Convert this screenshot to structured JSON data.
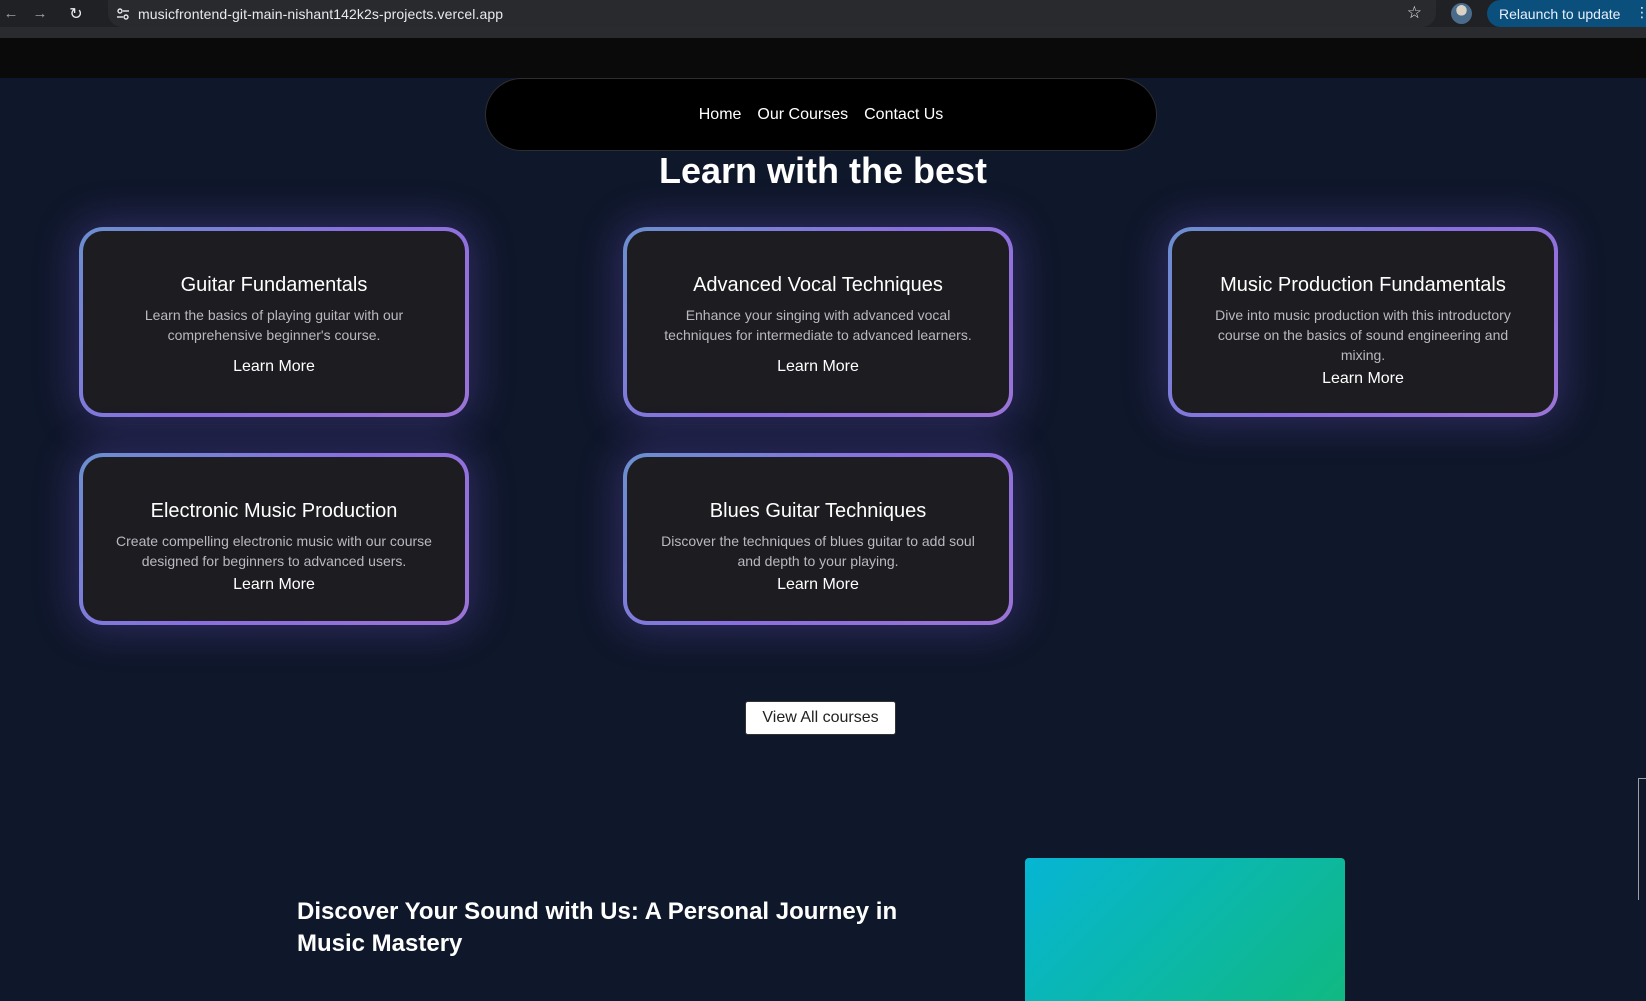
{
  "browser": {
    "url": "musicfrontend-git-main-nishant142k2s-projects.vercel.app",
    "relaunch_label": "Relaunch to update",
    "icons": {
      "back": "arrow-left-icon",
      "forward": "arrow-right-icon",
      "reload": "reload-icon",
      "site_info": "tune-icon",
      "bookmark": "star-icon",
      "menu": "kebab-icon"
    }
  },
  "navbar": {
    "links": [
      {
        "label": "Home"
      },
      {
        "label": "Our Courses"
      },
      {
        "label": "Contact Us"
      }
    ]
  },
  "courses_section": {
    "title": "Learn with the best",
    "cards": [
      {
        "title": "Guitar Fundamentals",
        "description": "Learn the basics of playing guitar with our comprehensive beginner's course.",
        "cta": "Learn More"
      },
      {
        "title": "Advanced Vocal Techniques",
        "description": "Enhance your singing with advanced vocal techniques for intermediate to advanced learners.",
        "cta": "Learn More"
      },
      {
        "title": "Music Production Fundamentals",
        "description": "Dive into music production with this introductory course on the basics of sound engineering and mixing.",
        "cta": "Learn More"
      },
      {
        "title": "Electronic Music Production",
        "description": "Create compelling electronic music with our course designed for beginners to advanced users.",
        "cta": "Learn More"
      },
      {
        "title": "Blues Guitar Techniques",
        "description": "Discover the techniques of blues guitar to add soul and depth to your playing.",
        "cta": "Learn More"
      }
    ],
    "view_all_label": "View All courses"
  },
  "discover_section": {
    "heading": "Discover Your Sound with Us: A Personal Journey in Music Mastery"
  },
  "colors": {
    "page_bg": "#0f172a",
    "card_bg": "#1c1c21",
    "card_border_start": "#6b8fcf",
    "card_border_end": "#9b73d6",
    "teal_start": "#06b6d4",
    "teal_end": "#10b981",
    "relaunch_bg": "#0b4f7c"
  }
}
